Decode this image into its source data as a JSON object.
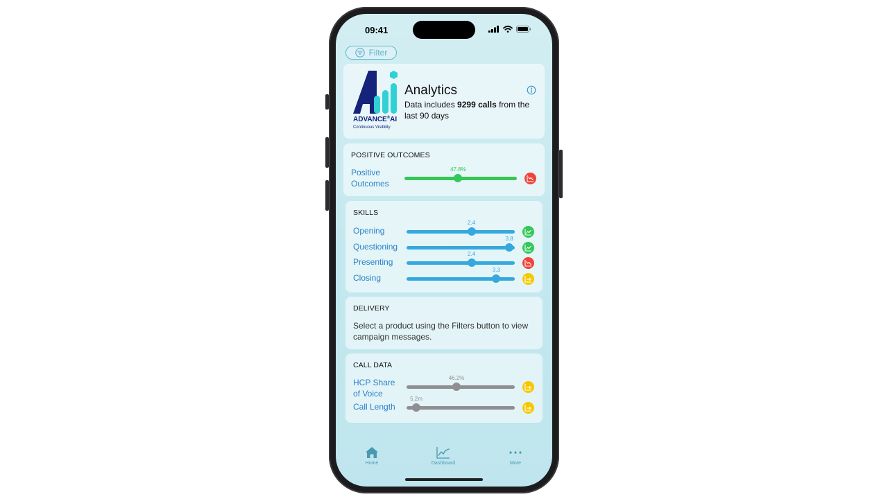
{
  "status_bar": {
    "time": "09:41"
  },
  "filter": {
    "label": "Filter"
  },
  "analytics": {
    "title": "Analytics",
    "desc_prefix": "Data includes ",
    "desc_bold": "9299 calls",
    "desc_suffix": " from the last 90 days",
    "logo_word": "ADVANCE",
    "logo_ai": "AI",
    "logo_tagline": "Continuous Visibility"
  },
  "positive_outcomes": {
    "title": "POSITIVE OUTCOMES",
    "rows": [
      {
        "label_line1": "Positive",
        "label_line2": "Outcomes",
        "value_text": "47.8%",
        "value_pct": 47.8,
        "trend": "down"
      }
    ]
  },
  "skills": {
    "title": "SKILLS",
    "rows": [
      {
        "label": "Opening",
        "value_text": "2.4",
        "fraction": 0.6,
        "trend": "up"
      },
      {
        "label": "Questioning",
        "value_text": "3.8",
        "fraction": 0.95,
        "trend": "up"
      },
      {
        "label": "Presenting",
        "value_text": "2.4",
        "fraction": 0.6,
        "trend": "down"
      },
      {
        "label": "Closing",
        "value_text": "3.3",
        "fraction": 0.83,
        "trend": "flat"
      }
    ]
  },
  "delivery": {
    "title": "DELIVERY",
    "message": "Select a product using the Filters button to view campaign messages."
  },
  "call_data": {
    "title": "CALL DATA",
    "rows": [
      {
        "label_line1": "HCP Share",
        "label_line2": "of Voice",
        "value_text": "46.2%",
        "fraction": 0.462,
        "trend": "flat"
      },
      {
        "label_line1": "Call Length",
        "label_line2": "",
        "value_text": "5.2m",
        "fraction": 0.09,
        "trend": "flat"
      }
    ]
  },
  "tabbar": {
    "items": [
      {
        "label": "Home",
        "icon": "home-icon"
      },
      {
        "label": "Dashboard",
        "icon": "chart-line-icon"
      },
      {
        "label": "More",
        "icon": "ellipsis-icon"
      }
    ]
  },
  "colors": {
    "green": "#34c759",
    "blue": "#35a8de",
    "gray": "#8e8e93",
    "trend_up": "#34c759",
    "trend_down": "#f04438",
    "trend_flat": "#f7c800",
    "link_blue": "#2a80c8",
    "logo_navy": "#15237a",
    "logo_teal": "#2fd1d6"
  }
}
